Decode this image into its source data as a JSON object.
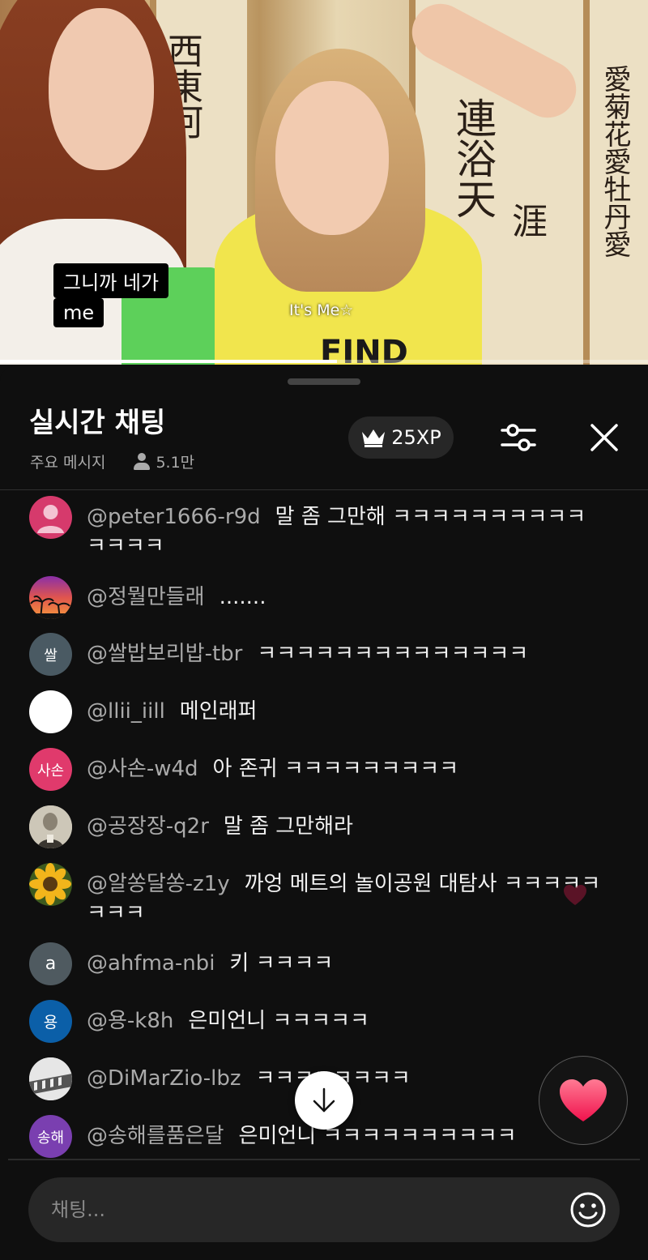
{
  "video": {
    "subtitle_line1": "그니까 네가",
    "subtitle_line2": "me",
    "caption": "It's Me☆",
    "shirt_text": "FIND",
    "progress": 0.52
  },
  "chat": {
    "title": "실시간 채팅",
    "mode_label": "주요 메시지",
    "viewer_count": "5.1만",
    "xp_label": "25XP",
    "input_placeholder": "채팅...",
    "messages": [
      {
        "author": "@peter1666-r9d",
        "text": "말 좀 그만해 ㅋㅋㅋㅋㅋㅋㅋㅋㅋㅋㅋㅋㅋㅋ",
        "avatar_text": "",
        "avatar_color": "#d63a6c"
      },
      {
        "author": "@정뭘만들래",
        "text": ".......",
        "avatar_text": "",
        "avatar_color": "#f58b45"
      },
      {
        "author": "@쌀밥보리밥-tbr",
        "text": "ㅋㅋㅋㅋㅋㅋㅋㅋㅋㅋㅋㅋㅋㅋ",
        "avatar_text": "쌀",
        "avatar_color": "#4a5a63"
      },
      {
        "author": "@llii_iill",
        "text": "메인래퍼",
        "avatar_text": "",
        "avatar_color": "#ffffff"
      },
      {
        "author": "@사손-w4d",
        "text": "아 존귀 ㅋㅋㅋㅋㅋㅋㅋㅋㅋ",
        "avatar_text": "사손",
        "avatar_color": "#e03a6c"
      },
      {
        "author": "@공장장-q2r",
        "text": "말 좀 그만해라",
        "avatar_text": "",
        "avatar_color": "#9a9487"
      },
      {
        "author": "@알쏭달쏭-z1y",
        "text": "까엉 메트의 놀이공원 대탐사 ㅋㅋㅋㅋㅋㅋㅋㅋ",
        "avatar_text": "",
        "avatar_color": "#e2a21a"
      },
      {
        "author": "@ahfma-nbi",
        "text": "키 ㅋㅋㅋㅋ",
        "avatar_text": "a",
        "avatar_color": "#4f5a60"
      },
      {
        "author": "@용-k8h",
        "text": "은미언니 ㅋㅋㅋㅋㅋ",
        "avatar_text": "용",
        "avatar_color": "#0b5fa8"
      },
      {
        "author": "@DiMarZio-lbz",
        "text": "ㅋㅋㅋㅋㅋㅋㅋㅋ",
        "avatar_text": "",
        "avatar_color": "#d9d9d9"
      },
      {
        "author": "@송해를품은달",
        "text": "은미언니 ㅋㅋㅋㅋㅋㅋㅋㅋㅋㅋ",
        "avatar_text": "송해",
        "avatar_color": "#7a3fb0"
      }
    ]
  },
  "icons": {
    "crown": "crown-icon",
    "filter": "tune-icon",
    "close": "close-icon",
    "scroll": "arrow-down-icon",
    "heart": "heart-icon",
    "emoji": "smiley-icon"
  }
}
